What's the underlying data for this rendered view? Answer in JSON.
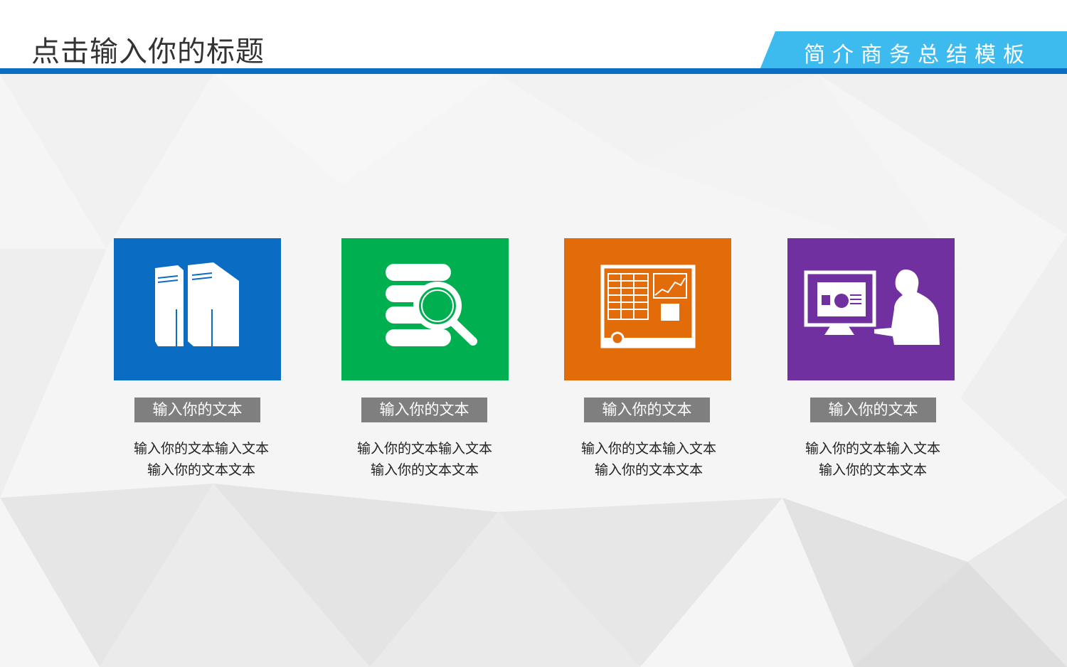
{
  "header": {
    "title": "点击输入你的标题",
    "tag": "简介商务总结模板",
    "line_color": "#0a6fc2",
    "tag_color": "#3dbbee"
  },
  "cards": [
    {
      "icon": "server-icon",
      "color": "#0a6cc2",
      "label": "输入你的文本",
      "desc_line1": "输入你的文本输入文本",
      "desc_line2": "输入你的文本文本"
    },
    {
      "icon": "database-search-icon",
      "color": "#00b050",
      "label": "输入你的文本",
      "desc_line1": "输入你的文本输入文本",
      "desc_line2": "输入你的文本文本"
    },
    {
      "icon": "dashboard-chart-icon",
      "color": "#e36c0a",
      "label": "输入你的文本",
      "desc_line1": "输入你的文本输入文本",
      "desc_line2": "输入你的文本文本"
    },
    {
      "icon": "user-at-computer-icon",
      "color": "#7030a0",
      "label": "输入你的文本",
      "desc_line1": "输入你的文本输入文本",
      "desc_line2": "输入你的文本文本"
    }
  ]
}
